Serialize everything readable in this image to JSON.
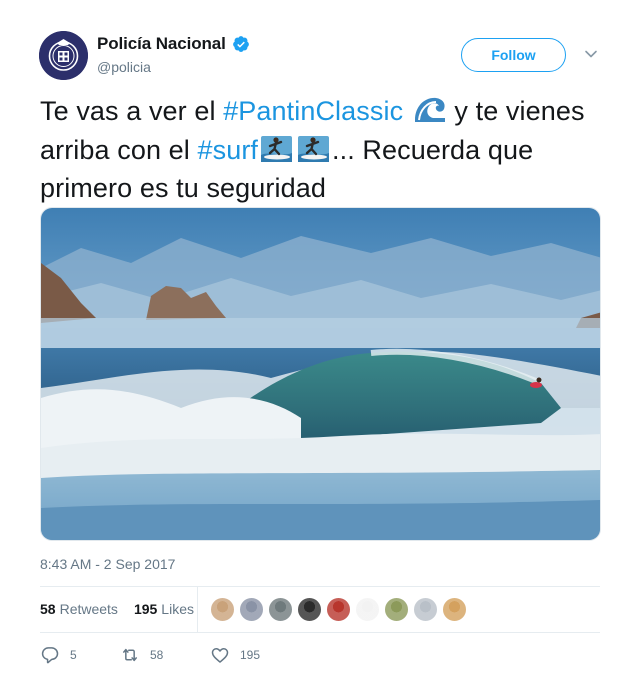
{
  "author": {
    "name": "Policía Nacional",
    "handle": "@policia",
    "verified": true,
    "avatar_icon": "police-badge-icon"
  },
  "follow_label": "Follow",
  "menu_icon": "chevron-down-icon",
  "tweet": {
    "text_1": "Te vas a ver el ",
    "hashtag_1": "#PantinClassic",
    "text_2": " y te vienes arriba con el ",
    "hashtag_2": "#surf",
    "text_3": "... Recuerda que primero es tu seguridad",
    "emojis": [
      "wave-emoji",
      "surfer-emoji",
      "surfer-emoji"
    ]
  },
  "timestamp": "8:43 AM - 2 Sep 2017",
  "stats": {
    "retweets_count": "58",
    "retweets_label": "Retweets",
    "likes_count": "195",
    "likes_label": "Likes"
  },
  "likers": [
    {
      "color": "#c9a27a"
    },
    {
      "color": "#8a93a6"
    },
    {
      "color": "#6f7a7c"
    },
    {
      "color": "#2b2b2b"
    },
    {
      "color": "#b8362d"
    },
    {
      "color": "#f2f2f2"
    },
    {
      "color": "#8c9a5a"
    },
    {
      "color": "#b9c0c8"
    },
    {
      "color": "#d4a15e"
    }
  ],
  "actions": {
    "reply_count": "5",
    "retweet_count": "58",
    "like_count": "195"
  },
  "colors": {
    "accent": "#1da1f2",
    "hashtag": "#1b95e0",
    "muted": "#657786",
    "text": "#14171a"
  }
}
